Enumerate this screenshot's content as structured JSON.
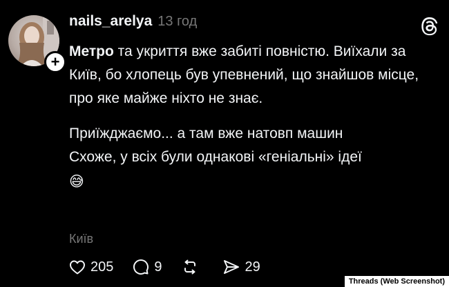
{
  "post": {
    "username": "nails_arelya",
    "time": "13 год",
    "text_mention": "Метро",
    "text_p1": " та укриття вже забиті повністю. Виїхали за Київ, бо хлопець був упевнений, що знайшов місце, про яке майже ніхто не знає.",
    "text_p2_line1": "Приїжджаємо... а там вже натовп машин",
    "text_p2_line2": "Схоже, у всіх були однакові «геніальні» ідеї",
    "emoji": "😅",
    "location": "Київ"
  },
  "actions": {
    "likes": "205",
    "comments": "9",
    "reposts": "",
    "shares": "29"
  },
  "credit": "Threads (Web Screenshot)",
  "icons": [
    "avatar",
    "plus-icon",
    "threads-logo-icon",
    "heart-icon",
    "comment-icon",
    "repost-icon",
    "share-icon"
  ]
}
